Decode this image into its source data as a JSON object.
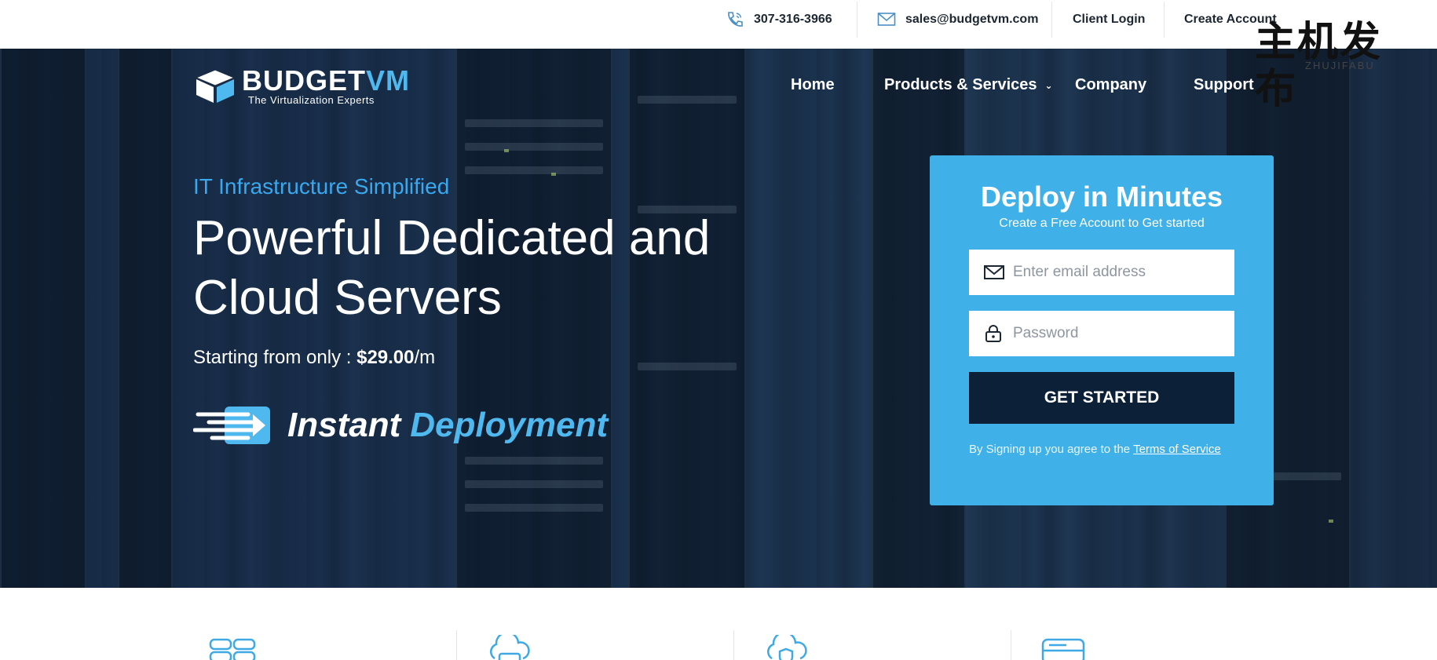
{
  "topbar": {
    "phone": "307-316-3966",
    "email": "sales@budgetvm.com",
    "client_login": "Client Login",
    "create_account": "Create Account"
  },
  "watermark": {
    "cn": "主机发布",
    "en": "ZHUJIFABU"
  },
  "logo": {
    "brand_main": "BUDGET",
    "brand_accent": "VM",
    "tagline": "The Virtualization Experts"
  },
  "nav": {
    "items": [
      {
        "label": "Home"
      },
      {
        "label": "Products & Services",
        "caret": "⌄"
      },
      {
        "label": "Company"
      },
      {
        "label": "Support"
      }
    ]
  },
  "hero": {
    "eyebrow": "IT Infrastructure Simplified",
    "headline": "Powerful Dedicated and Cloud Servers",
    "price_prefix": "Starting from only :",
    "price_value": "$29.00",
    "price_suffix": "/m",
    "instant_word1": "Instant",
    "instant_word2": "Deployment"
  },
  "signup": {
    "title": "Deploy in Minutes",
    "subtitle": "Create a Free Account to Get started",
    "email_placeholder": "Enter email address",
    "password_placeholder": "Password",
    "cta_label": "GET STARTED",
    "terms_prefix": "By Signing up you agree to the",
    "terms_link": "Terms of Service"
  },
  "features": {
    "icons": [
      "servers-icon",
      "cloud-server-icon",
      "cloud-shield-icon",
      "server-icon"
    ]
  },
  "colors": {
    "accent": "#3fb1e8",
    "eyebrow": "#3aa8ee",
    "cta_bg": "#0c2038",
    "hero_overlay": "#1e2e44"
  }
}
